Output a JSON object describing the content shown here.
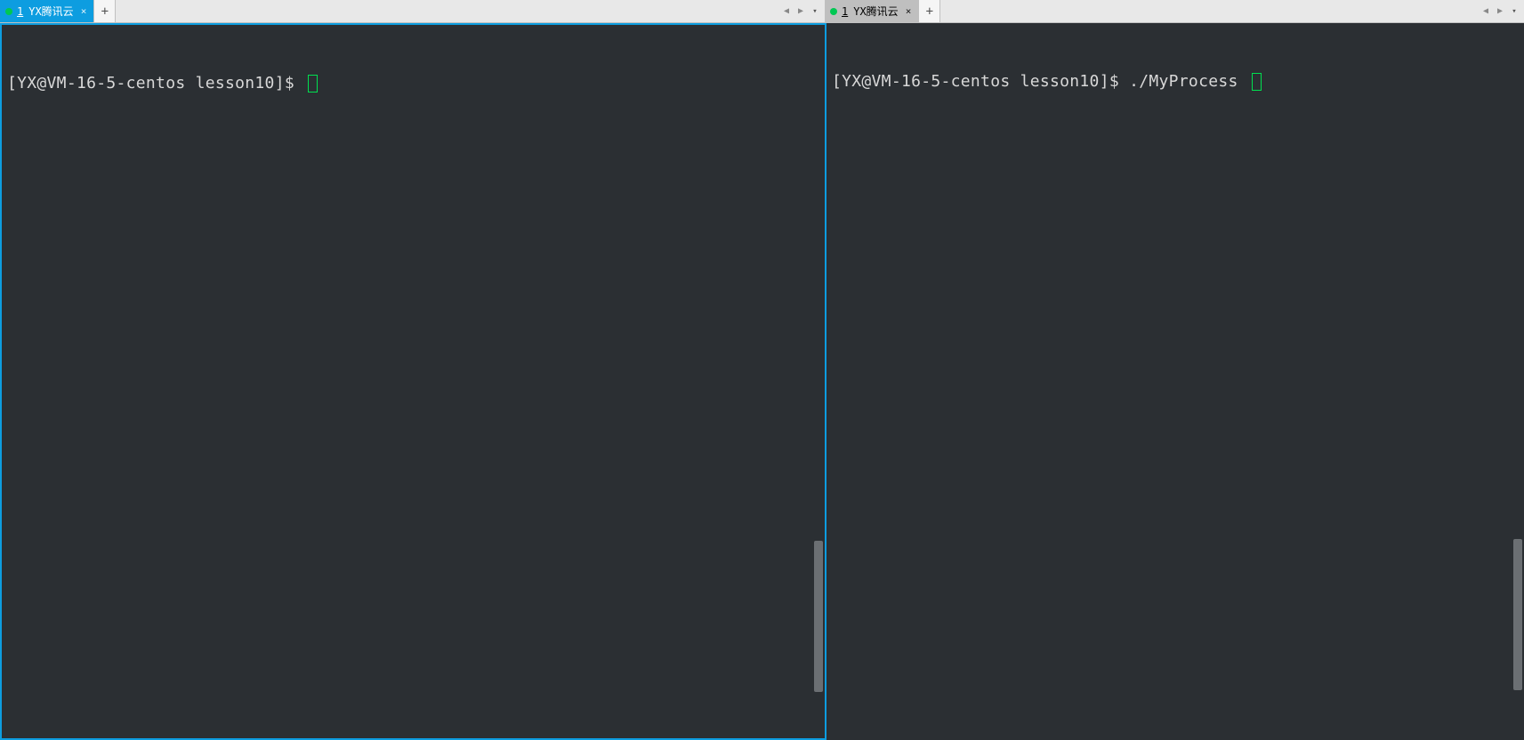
{
  "panes": [
    {
      "tab": {
        "index": "1",
        "title": "YX腾讯云",
        "close_glyph": "×",
        "active": true
      },
      "add_tab_glyph": "+",
      "nav_prev": "◀",
      "nav_next": "▶",
      "dropdown_glyph": "▾",
      "terminal": {
        "prompt": "[YX@VM-16-5-centos lesson10]$ ",
        "command": ""
      }
    },
    {
      "tab": {
        "index": "1",
        "title": "YX腾讯云",
        "close_glyph": "×",
        "active": false
      },
      "add_tab_glyph": "+",
      "nav_prev": "◀",
      "nav_next": "▶",
      "dropdown_glyph": "▾",
      "terminal": {
        "prompt": "[YX@VM-16-5-centos lesson10]$ ",
        "command": "./MyProcess "
      }
    }
  ]
}
